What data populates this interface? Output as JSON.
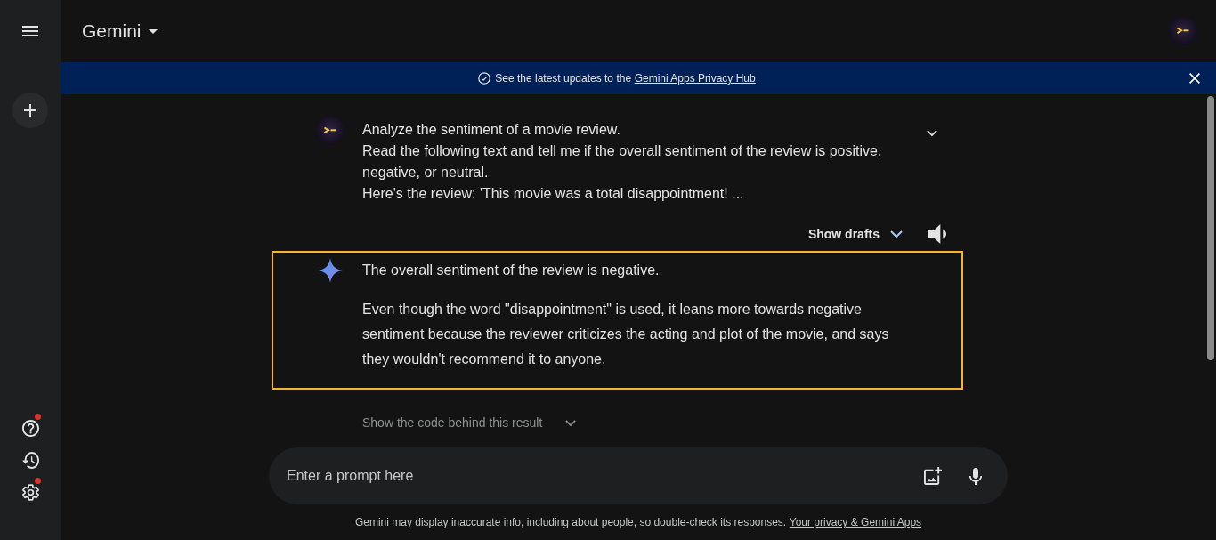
{
  "header": {
    "title": "Gemini"
  },
  "sidebar": {
    "items": [
      {
        "kind": "help",
        "notification": true
      },
      {
        "kind": "history",
        "notification": false
      },
      {
        "kind": "settings",
        "notification": true
      }
    ]
  },
  "banner": {
    "text": "See the latest updates to the",
    "link": "Gemini Apps Privacy Hub"
  },
  "conversation": {
    "prompt": {
      "lines": [
        "Analyze the sentiment of a movie review.",
        "Read the following text and tell me if the overall sentiment of the review is positive, negative, or neutral.",
        "Here's the review: 'This movie was a total disappointment! ..."
      ]
    },
    "drafts_button": "Show drafts",
    "response": {
      "highlighted": true,
      "paragraphs": [
        "The overall sentiment of the review is negative.",
        "Even though the word \"disappointment\" is used, it leans more towards negative sentiment because the reviewer criticizes the acting and plot of the movie, and says they wouldn't recommend it to anyone."
      ]
    },
    "code_toggle": "Show the code behind this result"
  },
  "composer": {
    "placeholder": "Enter a prompt here"
  },
  "footer": {
    "text": "Gemini may display inaccurate info, including about people, so double-check its responses.",
    "link": "Your privacy & Gemini Apps"
  }
}
